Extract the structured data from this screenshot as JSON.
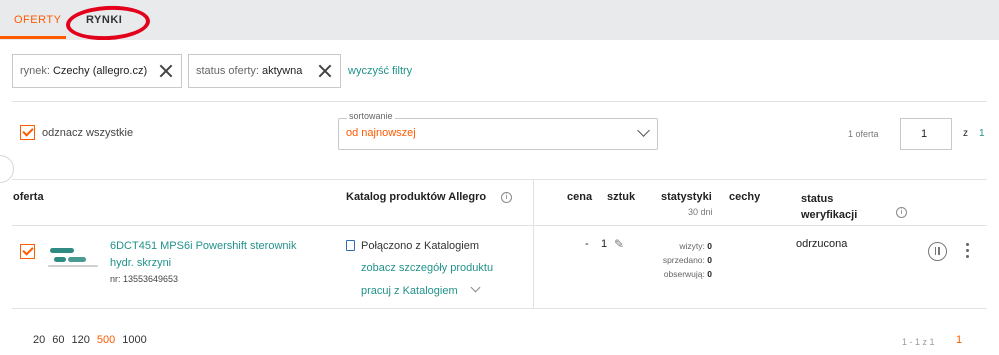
{
  "tabs": [
    {
      "label": "OFERTY",
      "active": true
    },
    {
      "label": "RYNKI",
      "active": false
    }
  ],
  "filters": {
    "chips": [
      {
        "label": "rynek:",
        "value": "Czechy (allegro.cz)"
      },
      {
        "label": "status oferty:",
        "value": "aktywna"
      }
    ],
    "clear_label": "wyczyść filtry"
  },
  "toolbar": {
    "select_all_label": "odznacz wszystkie",
    "sort_legend": "sortowanie",
    "sort_value": "od najnowszej",
    "offer_count": "1 oferta",
    "page_value": "1",
    "page_of": "z",
    "page_total": "1"
  },
  "table": {
    "headers": {
      "offer": "oferta",
      "catalog": "Katalog produktów Allegro",
      "price": "cena",
      "qty": "sztuk",
      "stats": "statystyki",
      "stats_sub": "30 dni",
      "features": "cechy",
      "verify": "status weryfikacji"
    },
    "rows": [
      {
        "title": "6DCT451 MPS6i Powershift sterownik hydr. skrzyni",
        "number": "nr: 13553649653",
        "catalog_status": "Połączono z Katalogiem",
        "catalog_link": "zobacz szczegóły produktu",
        "catalog_work": "pracuj z Katalogiem",
        "price": "-",
        "qty": "1",
        "stats": [
          {
            "label": "wizyty:",
            "value": "0"
          },
          {
            "label": "sprzedano:",
            "value": "0"
          },
          {
            "label": "obserwują:",
            "value": "0"
          }
        ],
        "verify_status": "odrzucona"
      }
    ]
  },
  "footer": {
    "page_sizes": [
      "20",
      "60",
      "120",
      "500",
      "1000"
    ],
    "active_page_size": "500",
    "range": "1 - 1 z 1",
    "current_page": "1"
  },
  "colors": {
    "accent": "#ff5a00",
    "link": "#21928a",
    "annotation": "#e3001b"
  }
}
